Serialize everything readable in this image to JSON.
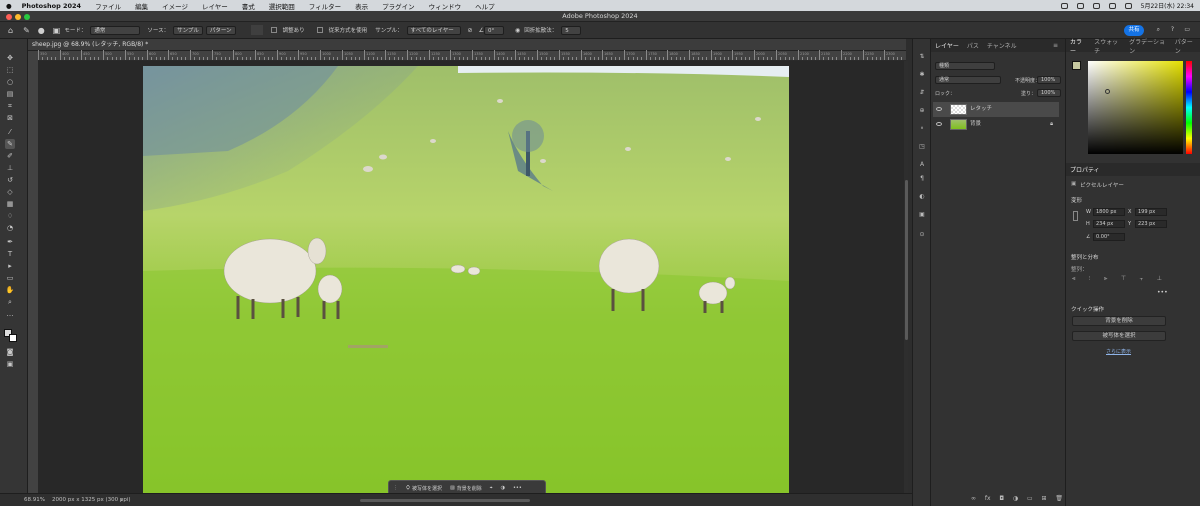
{
  "menubar": {
    "app": "Photoshop 2024",
    "items": [
      "ファイル",
      "編集",
      "イメージ",
      "レイヤー",
      "書式",
      "選択範囲",
      "フィルター",
      "表示",
      "プラグイン",
      "ウィンドウ",
      "ヘルプ"
    ],
    "datetime": "5月22日(水) 22:34"
  },
  "titlebar": {
    "title": "Adobe Photoshop 2024"
  },
  "options": {
    "mode_label": "モード：",
    "mode_value": "通常",
    "source_label": "ソース：",
    "sample": "サンプル",
    "pattern": "パターン",
    "aligned": "調整あり",
    "legacy": "従来方式を使用",
    "sample_label": "サンプル：",
    "sample_value": "すべてのレイヤー",
    "angle": "0°",
    "diffusion_label": "回折拡散法：",
    "diffusion_value": "5",
    "share": "共有"
  },
  "document": {
    "tab": "sheep.jpg @ 68.9% (レタッチ, RGB/8) *",
    "zoom": "68.91%",
    "info": "2000 px x 1325 px (300 ppi)"
  },
  "ruler_labels": [
    "350",
    "400",
    "450",
    "500",
    "550",
    "600",
    "650",
    "700",
    "750",
    "800",
    "850",
    "900",
    "950",
    "1000",
    "1050",
    "1100",
    "1150",
    "1200",
    "1250",
    "1300",
    "1350",
    "1400",
    "1450",
    "1500",
    "1550",
    "1600",
    "1650",
    "1700",
    "1750",
    "1800",
    "1850",
    "1900",
    "1950",
    "2000",
    "2050",
    "2100",
    "2150",
    "2200",
    "2250",
    "2300"
  ],
  "contextbar": {
    "select_subject": "被写体を選択",
    "remove_bg": "背景を削除"
  },
  "layers": {
    "tabs": [
      "レイヤー",
      "パス",
      "チャンネル"
    ],
    "kind": "種類",
    "blend": "通常",
    "opacity_label": "不透明度：",
    "opacity": "100%",
    "lock_label": "ロック：",
    "fill_label": "塗り：",
    "fill": "100%",
    "items": [
      {
        "name": "レタッチ",
        "selected": true
      },
      {
        "name": "背景",
        "selected": false
      }
    ]
  },
  "color": {
    "tabs": [
      "カラー",
      "スウォッチ",
      "グラデーション",
      "パターン"
    ]
  },
  "properties": {
    "tab": "プロパティ",
    "type": "ピクセルレイヤー",
    "transform": "変形",
    "w_label": "W",
    "w": "1800 px",
    "x_label": "X",
    "x": "199 px",
    "h_label": "H",
    "h": "234 px",
    "y_label": "Y",
    "y": "223 px",
    "angle": "0.00°",
    "align": "整列と分布",
    "align_sub": "整列：",
    "quick": "クイック操作",
    "remove_bg": "背景を削除",
    "select_subject": "被写体を選択",
    "more": "さらに表示"
  },
  "colors": {
    "accent": "#1473e6",
    "panel": "#323232",
    "canvas": "#282828"
  }
}
